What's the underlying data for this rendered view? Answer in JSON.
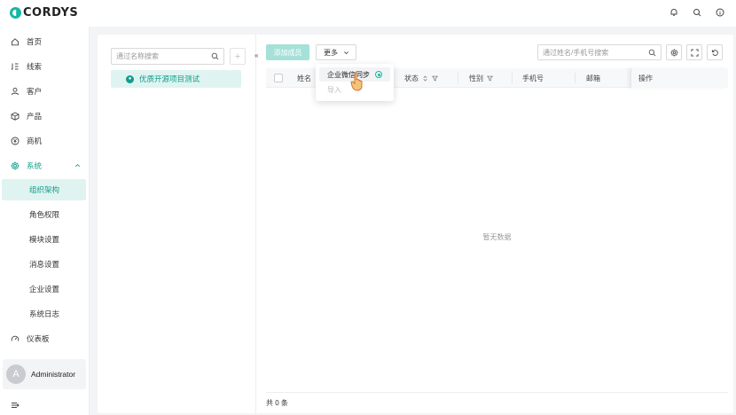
{
  "app": {
    "logo_text": "CORDYS"
  },
  "topbar": {
    "icons": [
      "bell-icon",
      "search-icon",
      "info-icon"
    ]
  },
  "sidebar": {
    "items": [
      {
        "label": "首页",
        "icon": "home-icon"
      },
      {
        "label": "线索",
        "icon": "lead-icon"
      },
      {
        "label": "客户",
        "icon": "user-icon"
      },
      {
        "label": "产品",
        "icon": "box-icon"
      },
      {
        "label": "商机",
        "icon": "opportunity-icon"
      },
      {
        "label": "系统",
        "icon": "gear-icon"
      }
    ],
    "sub_items": [
      "组织架构",
      "角色权限",
      "模块设置",
      "消息设置",
      "企业设置",
      "系统日志"
    ],
    "dashboard": {
      "label": "仪表板",
      "icon": "gauge-icon"
    },
    "user": {
      "initial": "A",
      "name": "Administrator"
    }
  },
  "dept_panel": {
    "search_placeholder": "通过名称搜索",
    "add_label": "+",
    "root_dept": "优质开源项目测试",
    "collapse_label": "«"
  },
  "toolbar": {
    "primary_label": "添加成员",
    "more_label": "更多",
    "member_search_placeholder": "通过姓名/手机号搜索"
  },
  "table": {
    "columns": [
      {
        "label": "姓名",
        "sort": false,
        "filter": false
      },
      {
        "label": "状态",
        "sort": true,
        "filter": true
      },
      {
        "label": "性别",
        "sort": false,
        "filter": true
      },
      {
        "label": "手机号",
        "sort": false,
        "filter": false
      },
      {
        "label": "邮箱",
        "sort": false,
        "filter": false
      },
      {
        "label": "操作",
        "sort": false,
        "filter": false
      }
    ],
    "empty_text": "暂无数据",
    "total_text": "共 0 条"
  },
  "dropdown": {
    "items": [
      {
        "label": "企业微信同步",
        "state": "hover"
      },
      {
        "label": "导入",
        "state": "disabled"
      }
    ]
  },
  "colors": {
    "accent": "#0f9d8a",
    "accent_light": "#dff4f1",
    "primary_disabled": "#a6e1d8"
  }
}
